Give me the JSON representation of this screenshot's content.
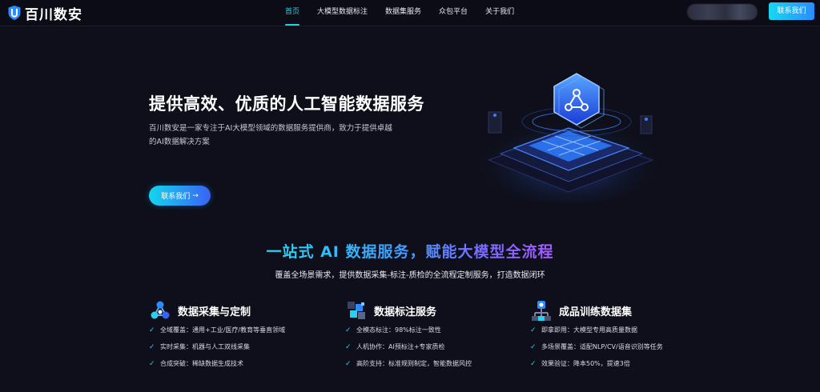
{
  "nav": {
    "brand": "百川数安",
    "links": [
      "首页",
      "大模型数据标注",
      "数据集服务",
      "众包平台",
      "关于我们"
    ],
    "active_index": 0,
    "contact": "联系我们"
  },
  "hero": {
    "title": "提供高效、优质的人工智能数据服务",
    "description": "百川数安是一家专注于AI大模型领域的数据服务提供商，致力于提供卓越的AI数据解决方案",
    "cta": "联系我们",
    "cta_icon": "arrow-right-icon"
  },
  "section": {
    "title": "一站式 AI 数据服务，赋能大模型全流程",
    "subtitle": "覆盖全场景需求，提供数据采集-标注-质检的全流程定制服务，打造数据闭环"
  },
  "columns": [
    {
      "title": "数据采集与定制",
      "icon": "network-nodes-icon",
      "features": [
        "全域覆盖：通用+工业/医疗/教育等垂直领域",
        "实时采集：机器与人工双线采集",
        "合成突破：稀缺数据生成技术"
      ]
    },
    {
      "title": "数据标注服务",
      "icon": "data-blocks-icon",
      "features": [
        "全模态标注：98%标注一致性",
        "人机协作：AI预标注+专家质检",
        "高阶支持：标准规则制定，智能数据风控"
      ]
    },
    {
      "title": "成品训练数据集",
      "icon": "dataset-tree-icon",
      "features": [
        "即拿即用：大模型专用高质量数据",
        "多场景覆盖：适配NLP/CV/语音识别等任务",
        "效果验证：降本50%，提速3倍"
      ]
    }
  ],
  "colors": {
    "accent": "#22d3e6",
    "brand_blue": "#2b8cff",
    "background": "#0e0f1a"
  }
}
